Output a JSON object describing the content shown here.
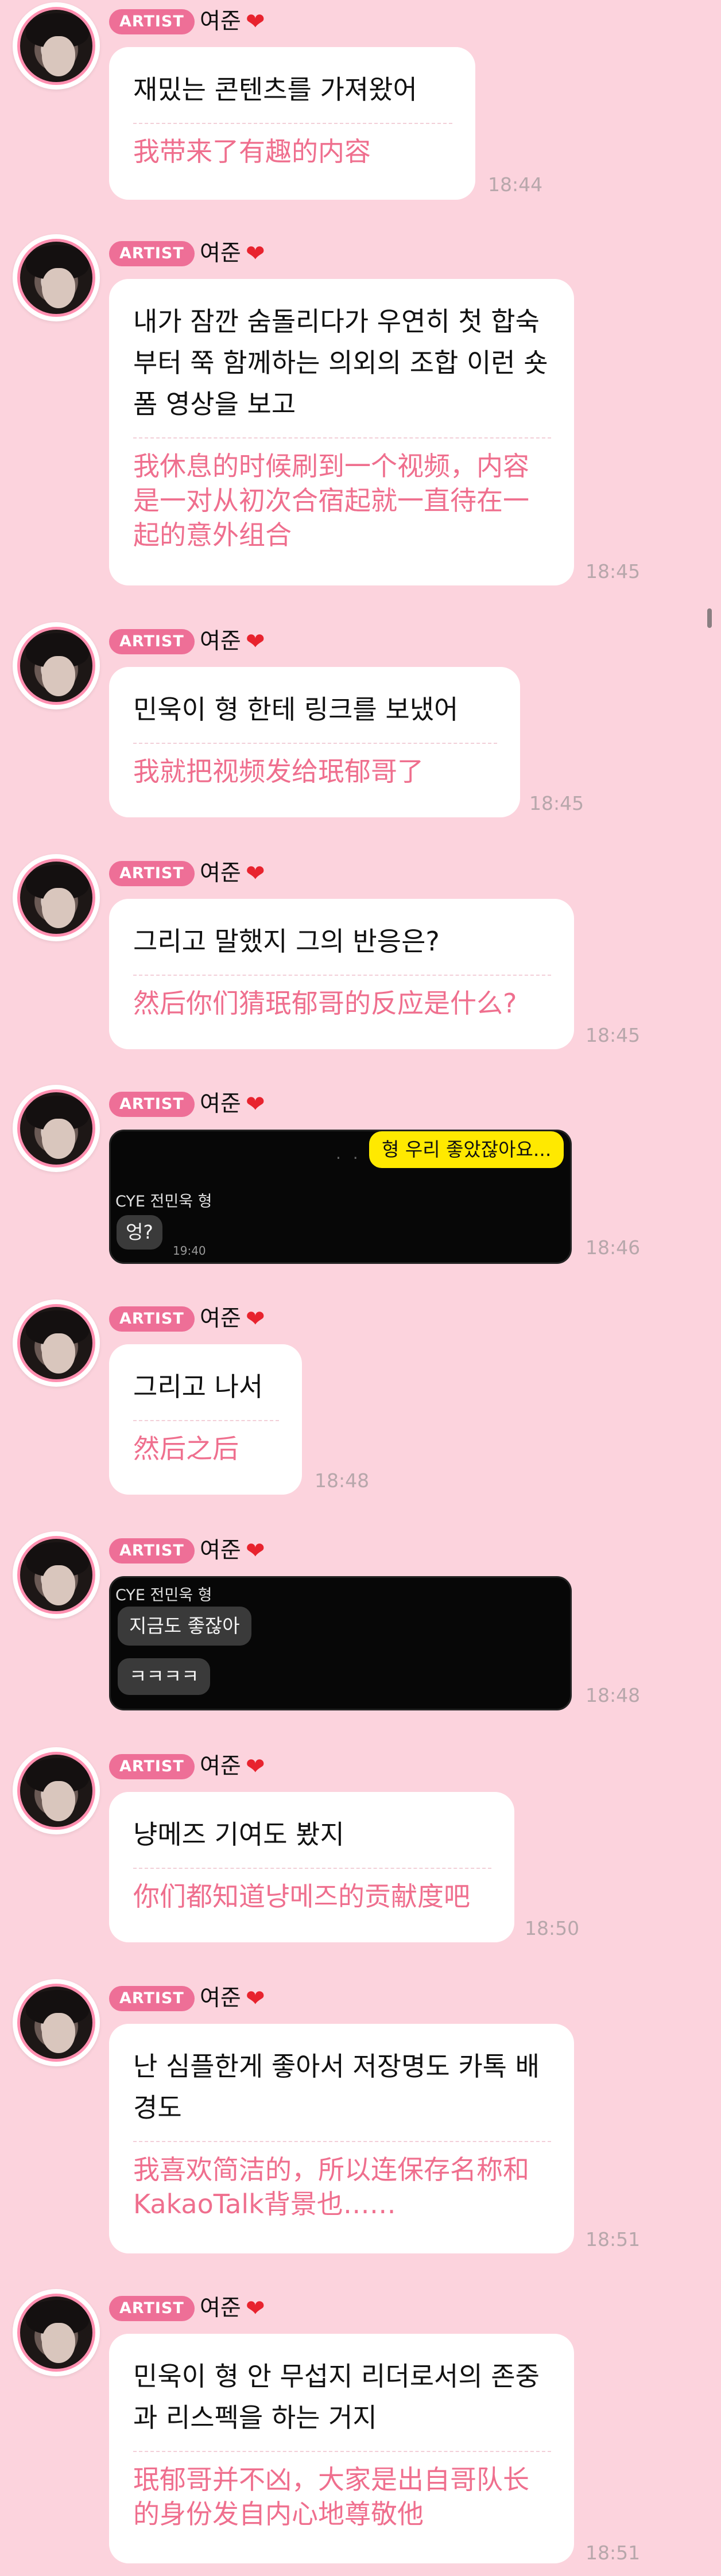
{
  "artist_tag": "ARTIST",
  "sender_name": "여준",
  "heart_icon": "❤",
  "messages": [
    {
      "ko": "재밌는 콘텐츠를 가져왔어",
      "zh": "我带来了有趣的内容",
      "time": "18:44"
    },
    {
      "ko": "내가 잠깐 숨돌리다가 우연히 첫 합숙부터 쭉 함께하는 의외의 조합 이런 숏폼 영상을 보고",
      "zh": "我休息的时候刷到一个视频，内容是一对从初次合宿起就一直待在一起的意外组合",
      "time": "18:45"
    },
    {
      "ko": "민욱이 형 한테 링크를 보냈어",
      "zh": "我就把视频发给珉郁哥了",
      "time": "18:45"
    },
    {
      "ko": "그리고 말했지 그의 반응은?",
      "zh": "然后你们猜珉郁哥的反应是什么?",
      "time": "18:45"
    },
    {
      "time": "18:46",
      "shot": {
        "sent": "형 우리 좋았잖아요...",
        "contact": "CYE 전민욱 형",
        "reply": "엉?",
        "reply_time": "19:40"
      }
    },
    {
      "ko": "그리고 나서",
      "zh": "然后之后",
      "time": "18:48"
    },
    {
      "time": "18:48",
      "shot": {
        "contact": "CYE 전민욱 형",
        "reply1": "지금도 좋잖아",
        "reply2": "ㅋㅋㅋㅋ"
      }
    },
    {
      "ko": "냥메즈 기여도 봤지",
      "zh": "你们都知道냥메즈的贡献度吧",
      "time": "18:50"
    },
    {
      "ko": "난 심플한게 좋아서 저장명도 카톡 배경도",
      "zh": "我喜欢简洁的，所以连保存名称和KakaoTalk背景也……",
      "time": "18:51"
    },
    {
      "ko": "민욱이 형 안 무섭지 리더로서의 존중과 리스펙을 하는 거지",
      "zh": "珉郁哥并不凶，大家是出自哥队长的身份发自内心地尊敬他",
      "time": "18:51"
    }
  ]
}
